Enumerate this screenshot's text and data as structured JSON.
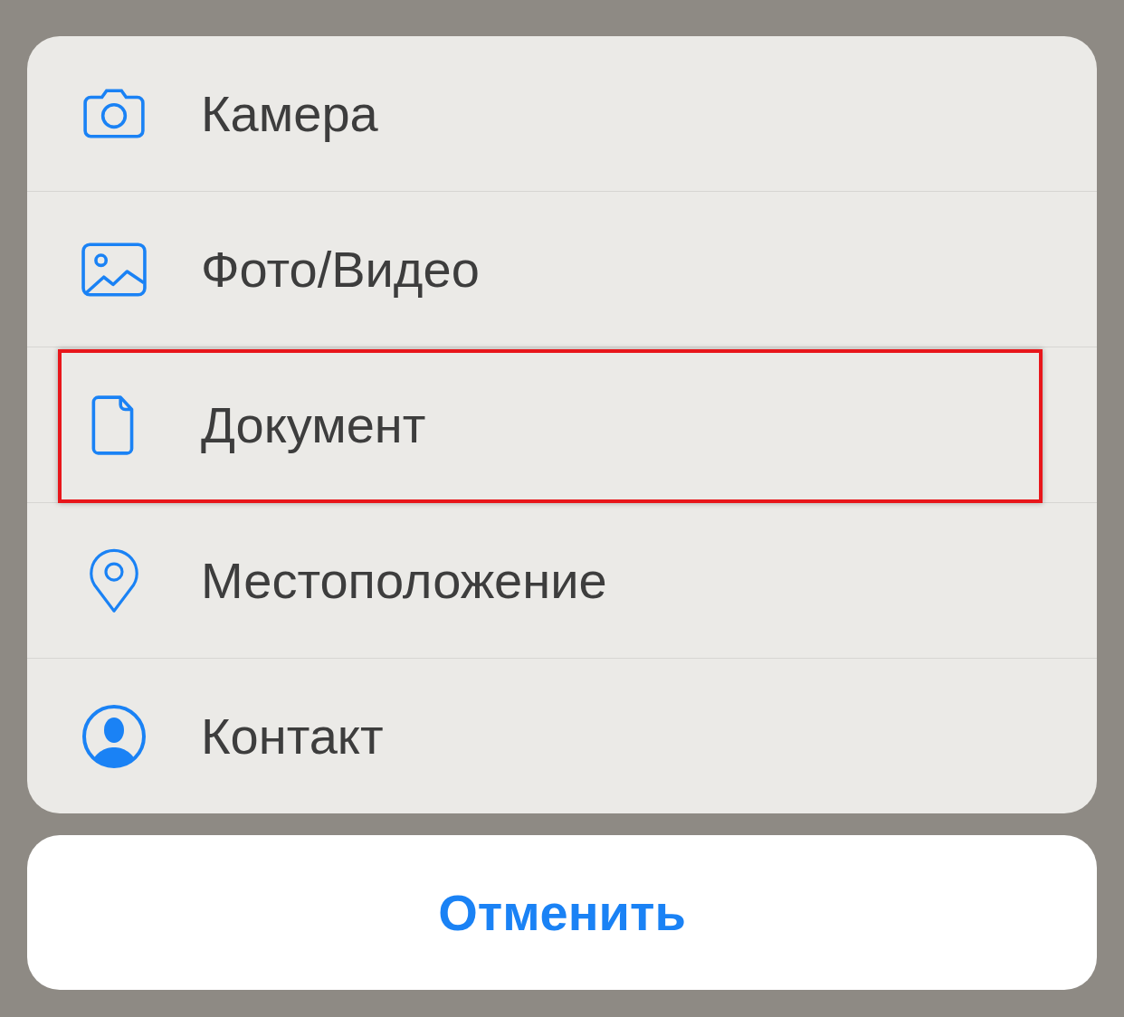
{
  "action_sheet": {
    "items": [
      {
        "label": "Камера",
        "kind": "camera",
        "highlighted": false
      },
      {
        "label": "Фото/Видео",
        "kind": "photo",
        "highlighted": false
      },
      {
        "label": "Документ",
        "kind": "document",
        "highlighted": true
      },
      {
        "label": "Местоположение",
        "kind": "location",
        "highlighted": false
      },
      {
        "label": "Контакт",
        "kind": "contact",
        "highlighted": false
      }
    ]
  },
  "cancel_button": {
    "label": "Отменить"
  }
}
